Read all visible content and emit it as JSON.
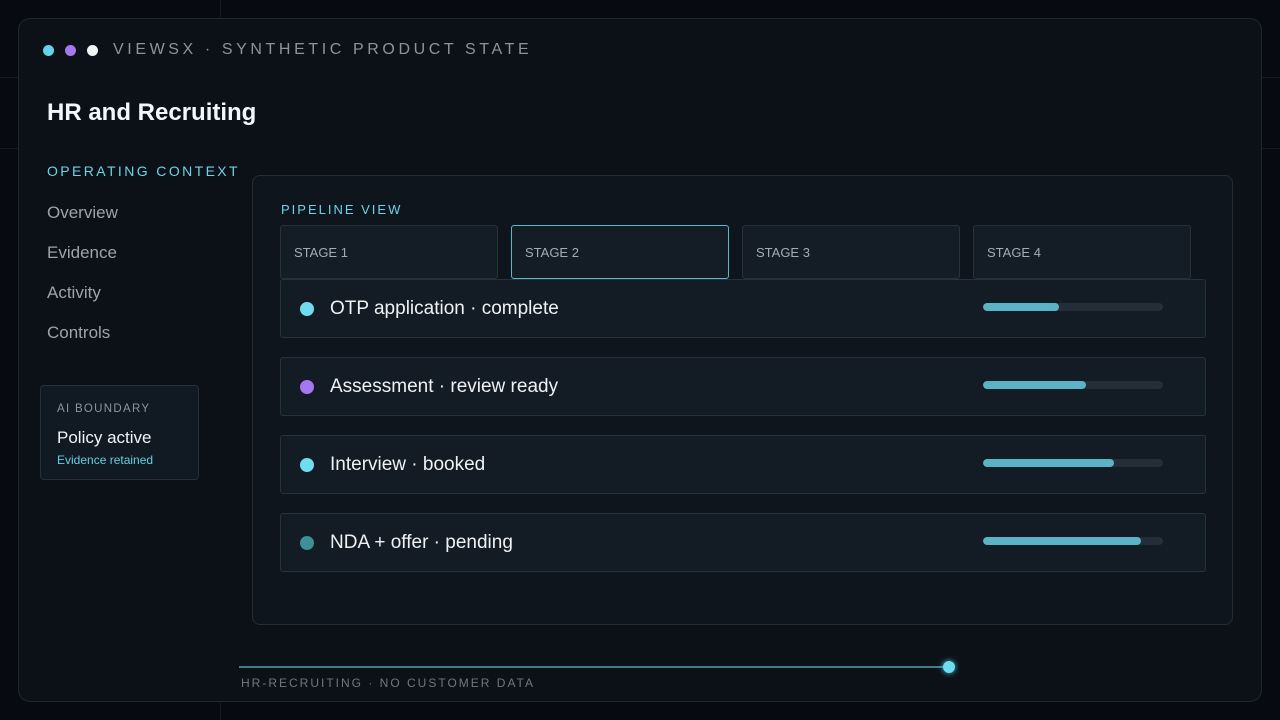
{
  "app": {
    "title": "VIEWSX · SYNTHETIC PRODUCT STATE",
    "window_dots": [
      "#63d3ea",
      "#a678f0",
      "#f2f4f6"
    ]
  },
  "page": {
    "title": "HR and Recruiting"
  },
  "sidebar": {
    "context_label": "OPERATING CONTEXT",
    "items": [
      {
        "label": "Overview"
      },
      {
        "label": "Evidence"
      },
      {
        "label": "Activity"
      },
      {
        "label": "Controls"
      }
    ]
  },
  "ai_boundary": {
    "label": "AI BOUNDARY",
    "status": "Policy active",
    "detail": "Evidence retained"
  },
  "pipeline": {
    "label": "PIPELINE VIEW",
    "stages": [
      {
        "label": "STAGE 1",
        "active": false
      },
      {
        "label": "STAGE 2",
        "active": true
      },
      {
        "label": "STAGE 3",
        "active": false
      },
      {
        "label": "STAGE 4",
        "active": false
      }
    ],
    "rows": [
      {
        "label": "OTP application · complete",
        "dot_color": "#6fdcf0",
        "progress": 0.42
      },
      {
        "label": "Assessment · review ready",
        "dot_color": "#a678f0",
        "progress": 0.57
      },
      {
        "label": "Interview · booked",
        "dot_color": "#6fdcf0",
        "progress": 0.73
      },
      {
        "label": "NDA + offer · pending",
        "dot_color": "#3f8f96",
        "progress": 0.88
      }
    ]
  },
  "footer": {
    "text": "HR-RECRUITING · NO CUSTOMER DATA"
  }
}
